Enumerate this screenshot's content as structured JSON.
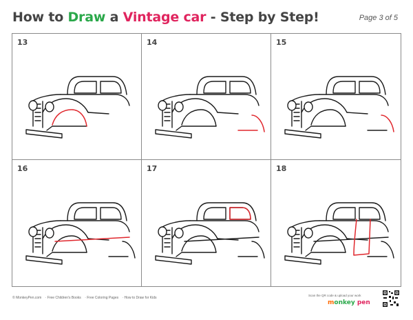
{
  "header": {
    "title_parts": [
      "How to ",
      "Draw",
      " a ",
      "Vintage car",
      " - Step by Step!"
    ],
    "page": "Page 3 of 5"
  },
  "steps": [
    {
      "number": "13"
    },
    {
      "number": "14"
    },
    {
      "number": "15"
    },
    {
      "number": "16"
    },
    {
      "number": "17"
    },
    {
      "number": "18"
    }
  ],
  "footer": {
    "links": [
      "© MonkeyPen.com",
      "· Free Children's Books",
      "· Free Coloring Pages",
      "· How to Draw for Kids"
    ],
    "scan_text": "Scan the QR code & upload your work",
    "brand": [
      "m",
      "onkey",
      " pen"
    ]
  },
  "colors": {
    "accent_green": "#2aa84a",
    "accent_red": "#e0245e",
    "highlight_stroke": "#e0262c",
    "line": "#1a1a1a"
  }
}
